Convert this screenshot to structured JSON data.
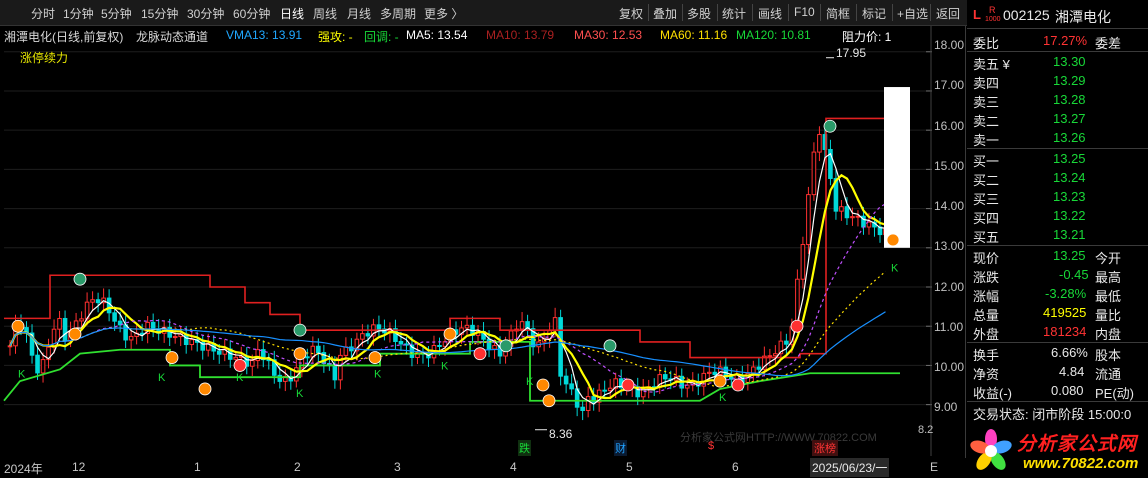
{
  "toolbar": {
    "periods": [
      "分时",
      "1分钟",
      "5分钟",
      "15分钟",
      "30分钟",
      "60分钟",
      "日线",
      "周线",
      "月线",
      "多周期",
      "更多 〉"
    ],
    "active_period": "日线",
    "right_items": [
      "复权",
      "叠加",
      "多股",
      "统计",
      "画线",
      "F10",
      "简框",
      "标记",
      "+自选",
      "返回"
    ]
  },
  "legend": {
    "stock_title": "湘潭电化(日线,前复权)",
    "indicator_name": "龙脉动态通道",
    "vma13": "VMA13: 13.91",
    "strong": "强攻: -",
    "pullback": "回调: -",
    "ma5": "MA5: 13.54",
    "ma10": "MA10: 13.79",
    "ma30": "MA30: 12.53",
    "ma60": "MA60: 11.16",
    "ma120": "MA120: 10.81",
    "resistance": "阻力价: 1"
  },
  "indicator_label": "涨停续力",
  "price_axis": [
    "18.00",
    "17.00",
    "16.00",
    "15.00",
    "14.00",
    "13.00",
    "12.00",
    "11.00",
    "10.00",
    "9.00",
    "8.2"
  ],
  "annotations": {
    "high_label": "17.95",
    "low_label": "8.36",
    "watermark": "分析家公式网HTTP://WWW.70822.COM",
    "event_die": "跌",
    "event_cai": "财",
    "event_dollar": "$",
    "event_zhangbang": "涨榜"
  },
  "date_axis": {
    "labels": [
      "2024年",
      "12",
      "1",
      "2",
      "3",
      "4",
      "5",
      "6"
    ],
    "cursor_date": "2025/06/23/一",
    "right_marker": "E"
  },
  "quote": {
    "flag_l": "L",
    "flag_r": "R",
    "flag_num": "1000",
    "code": "002125",
    "name": "湘潭电化",
    "weibi_label": "委比",
    "weibi_value": "17.27%",
    "weicha_label": "委差",
    "asks": [
      {
        "label": "卖五 ¥",
        "price": "13.30"
      },
      {
        "label": "卖四",
        "price": "13.29"
      },
      {
        "label": "卖三",
        "price": "13.28"
      },
      {
        "label": "卖二",
        "price": "13.27"
      },
      {
        "label": "卖一",
        "price": "13.26"
      }
    ],
    "bids": [
      {
        "label": "买一",
        "price": "13.25"
      },
      {
        "label": "买二",
        "price": "13.24"
      },
      {
        "label": "买三",
        "price": "13.23"
      },
      {
        "label": "买四",
        "price": "13.22"
      },
      {
        "label": "买五",
        "price": "13.21"
      }
    ],
    "stats": [
      {
        "label": "现价",
        "value": "13.25",
        "label2": "今开"
      },
      {
        "label": "涨跌",
        "value": "-0.45",
        "label2": "最高"
      },
      {
        "label": "涨幅",
        "value": "-3.28%",
        "label2": "最低"
      },
      {
        "label": "总量",
        "value": "419525",
        "label2": "量比"
      },
      {
        "label": "外盘",
        "value": "181234",
        "label2": "内盘"
      }
    ],
    "stats2": [
      {
        "label": "换手",
        "value": "6.66%",
        "label2": "股本"
      },
      {
        "label": "净资",
        "value": "4.84",
        "label2": "流通"
      },
      {
        "label": "收益(-)",
        "value": "0.080",
        "label2": "PE(动)"
      }
    ],
    "trade_status": "交易状态: 闭市阶段 15:00:0"
  },
  "logo": {
    "title": "分析家公式网",
    "url": "www.70822.com"
  },
  "colors": {
    "up": "#ff3333",
    "down": "#18d838",
    "cyan": "#00e0e0",
    "yellow": "#ffff00",
    "resistance_line": "#e02020",
    "support_line": "#30e030"
  },
  "chart_data": {
    "type": "line",
    "ylim": [
      8.2,
      18.3
    ],
    "x": [
      "2024-11",
      "2024-12",
      "2025-01",
      "2025-02",
      "2025-03",
      "2025-04",
      "2025-05",
      "2025-06"
    ],
    "series": [
      {
        "name": "MA5",
        "values": [
          10.9,
          11.6,
          10.2,
          10.6,
          11.0,
          9.3,
          9.9,
          13.54
        ]
      },
      {
        "name": "MA10",
        "values": [
          10.8,
          11.5,
          10.3,
          10.7,
          11.1,
          9.6,
          9.8,
          13.79
        ]
      },
      {
        "name": "MA30",
        "values": [
          10.6,
          11.0,
          10.5,
          10.6,
          10.9,
          10.2,
          9.9,
          12.53
        ]
      },
      {
        "name": "MA60",
        "values": [
          10.2,
          10.6,
          10.5,
          10.5,
          10.8,
          10.5,
          10.0,
          11.16
        ]
      },
      {
        "name": "MA120",
        "values": [
          9.8,
          10.1,
          10.2,
          10.3,
          10.5,
          10.5,
          10.2,
          10.81
        ]
      }
    ]
  }
}
